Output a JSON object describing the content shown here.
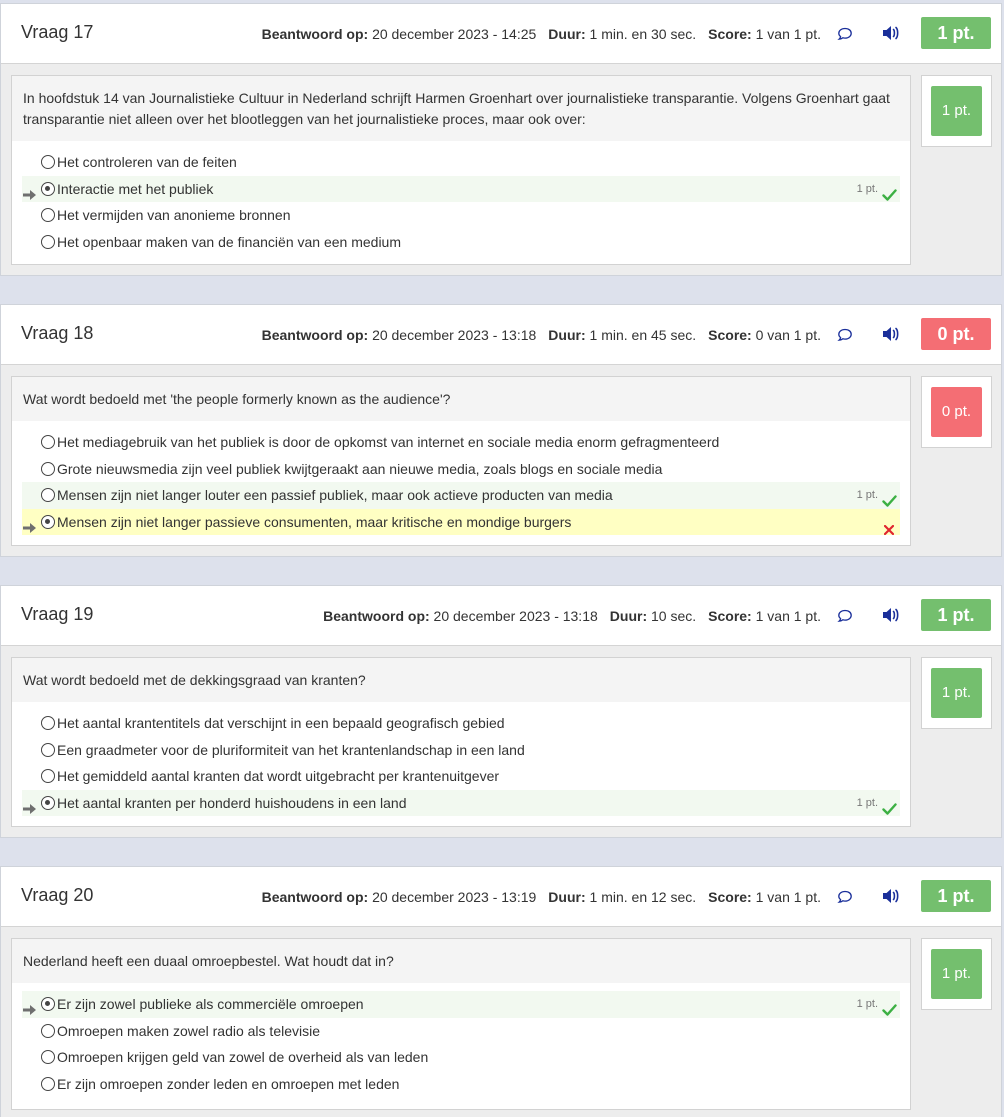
{
  "labels": {
    "answered_on": "Beantwoord op:",
    "duration": "Duur:",
    "score": "Score:"
  },
  "colors": {
    "correct": "#74bf6e",
    "incorrect": "#f46e74",
    "correct_row": "#f2f9f0",
    "wrong_row": "#ffffc3",
    "speaker": "#1a2f9a"
  },
  "questions": [
    {
      "title": "Vraag 17",
      "answered_on": "20 december 2023 - 14:25",
      "duration": "1 min. en 30 sec.",
      "score": "1 van 1 pt.",
      "badge": "1 pt.",
      "badge_status": "correct",
      "text": "In hoofdstuk 14 van Journalistieke Cultuur in Nederland schrijft Harmen Groenhart over journalistieke transparantie. Volgens Groenhart gaat transparantie niet alleen over het blootleggen van het journalistieke proces, maar ook over:",
      "options": [
        {
          "label": "Het controleren van de feiten"
        },
        {
          "label": "Interactie met het publiek",
          "selected": true,
          "correct": true,
          "points": "1 pt."
        },
        {
          "label": "Het vermijden van anonieme bronnen"
        },
        {
          "label": "Het openbaar maken van de financiën van een medium"
        }
      ]
    },
    {
      "title": "Vraag 18",
      "answered_on": "20 december 2023 - 13:18",
      "duration": "1 min. en 45 sec.",
      "score": "0 van 1 pt.",
      "badge": "0 pt.",
      "badge_status": "incorrect",
      "text": "Wat wordt bedoeld met 'the people formerly known as the audience'?",
      "options": [
        {
          "label": "Het mediagebruik van het publiek is door de opkomst van internet en sociale media enorm gefragmenteerd"
        },
        {
          "label": "Grote nieuwsmedia zijn veel publiek kwijtgeraakt aan nieuwe media, zoals blogs en sociale media"
        },
        {
          "label": "Mensen zijn niet langer louter een passief publiek, maar ook actieve producten van media",
          "correct": true,
          "points": "1 pt."
        },
        {
          "label": "Mensen zijn niet langer passieve consumenten, maar kritische en mondige burgers",
          "selected": true,
          "wrong": true
        }
      ]
    },
    {
      "title": "Vraag 19",
      "answered_on": "20 december 2023 - 13:18",
      "duration": "10 sec.",
      "score": "1 van 1 pt.",
      "badge": "1 pt.",
      "badge_status": "correct",
      "text": "Wat wordt bedoeld met de dekkingsgraad van kranten?",
      "options": [
        {
          "label": "Het aantal krantentitels dat verschijnt in een bepaald geografisch gebied"
        },
        {
          "label": "Een graadmeter voor de pluriformiteit van het krantenlandschap in een land"
        },
        {
          "label": "Het gemiddeld aantal kranten dat wordt uitgebracht per krantenuitgever"
        },
        {
          "label": "Het aantal kranten per honderd huishoudens in een land",
          "selected": true,
          "correct": true,
          "points": "1 pt."
        }
      ]
    },
    {
      "title": "Vraag 20",
      "answered_on": "20 december 2023 - 13:19",
      "duration": "1 min. en 12 sec.",
      "score": "1 van 1 pt.",
      "badge": "1 pt.",
      "badge_status": "correct",
      "text": "Nederland heeft een duaal omroepbestel. Wat houdt dat in?",
      "options": [
        {
          "label": "Er zijn zowel publieke als commerciële omroepen",
          "selected": true,
          "correct": true,
          "points": "1 pt."
        },
        {
          "label": "Omroepen maken zowel radio als televisie"
        },
        {
          "label": "Omroepen krijgen geld van zowel de overheid als van leden"
        },
        {
          "label": "Er zijn omroepen zonder leden en omroepen met leden"
        }
      ]
    }
  ]
}
